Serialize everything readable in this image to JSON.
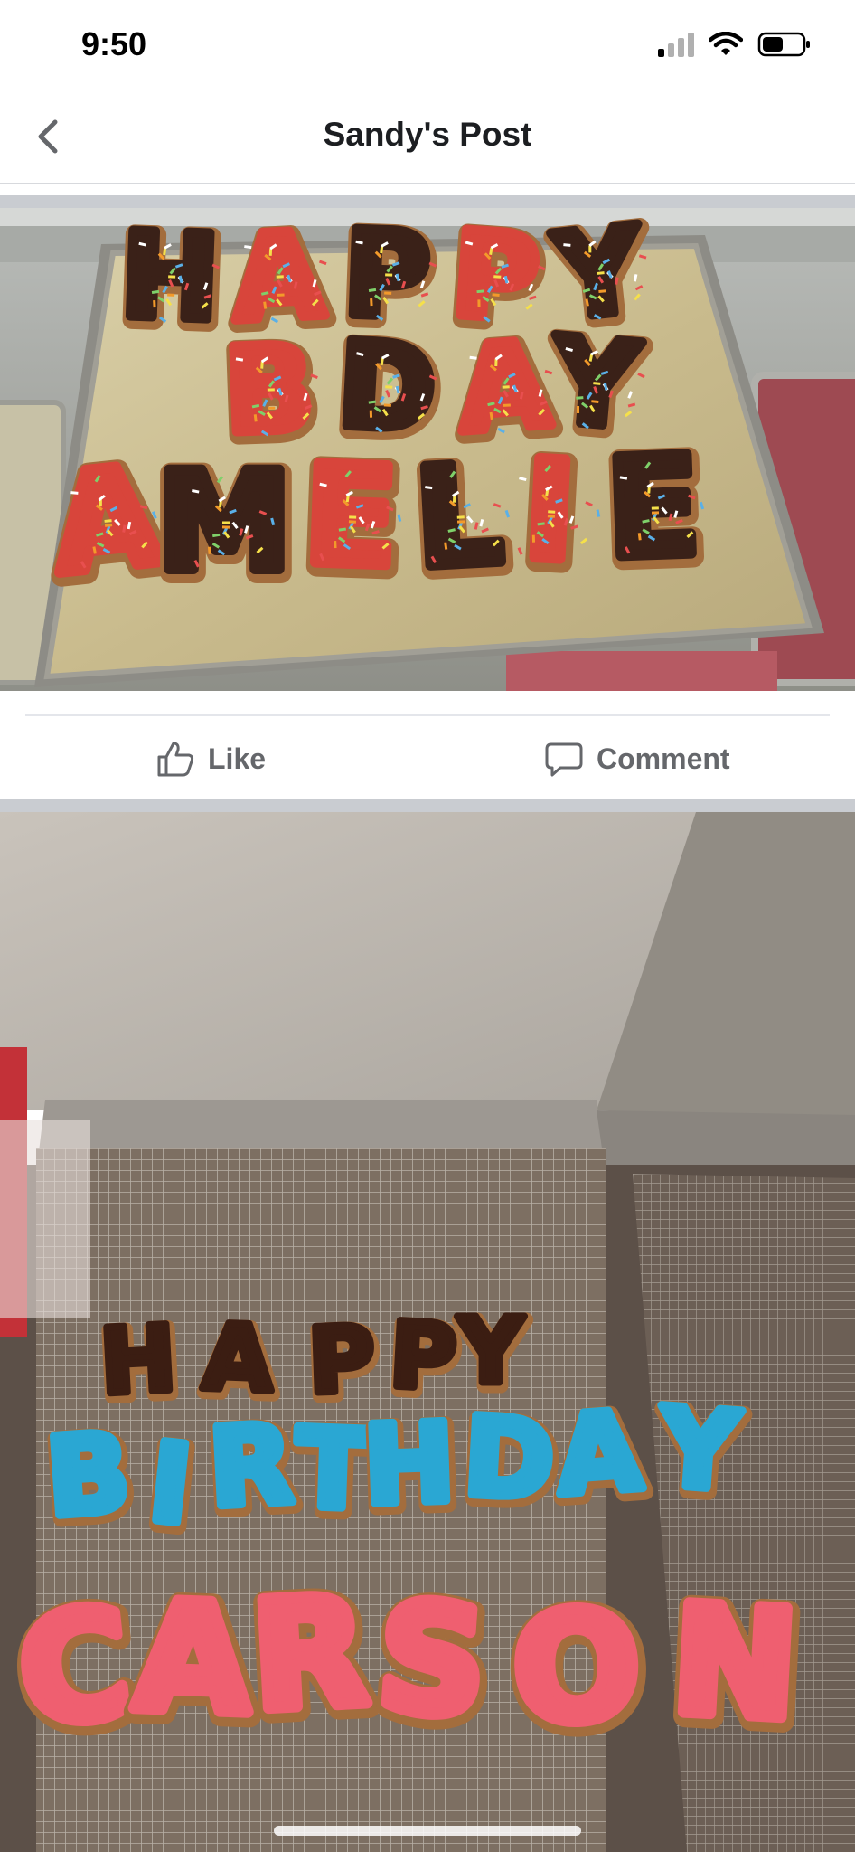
{
  "status_bar": {
    "time": "9:50",
    "signal_icon": "cellular-signal-icon",
    "wifi_icon": "wifi-icon",
    "battery_icon": "battery-icon"
  },
  "header": {
    "title": "Sandy's Post",
    "back_icon": "chevron-left-icon"
  },
  "photos": [
    {
      "description_name": "donut-tray-photo",
      "donut_letters": [
        "H",
        "A",
        "P",
        "P",
        "Y",
        "B",
        "D",
        "A",
        "Y",
        "A",
        "M",
        "E",
        "L",
        "I",
        "E"
      ]
    },
    {
      "description_name": "donut-rack-photo",
      "donut_letters": [
        "H",
        "A",
        "P",
        "P",
        "Y",
        "B",
        "I",
        "R",
        "T",
        "H",
        "D",
        "A",
        "Y",
        "C",
        "A",
        "R",
        "S",
        "O",
        "N"
      ]
    }
  ],
  "actions": {
    "like_label": "Like",
    "comment_label": "Comment",
    "like_icon": "thumbs-up-icon",
    "comment_icon": "comment-bubble-icon"
  },
  "colors": {
    "action_text": "#65676b",
    "divider": "#c9ccd1",
    "title": "#1c1e21"
  }
}
